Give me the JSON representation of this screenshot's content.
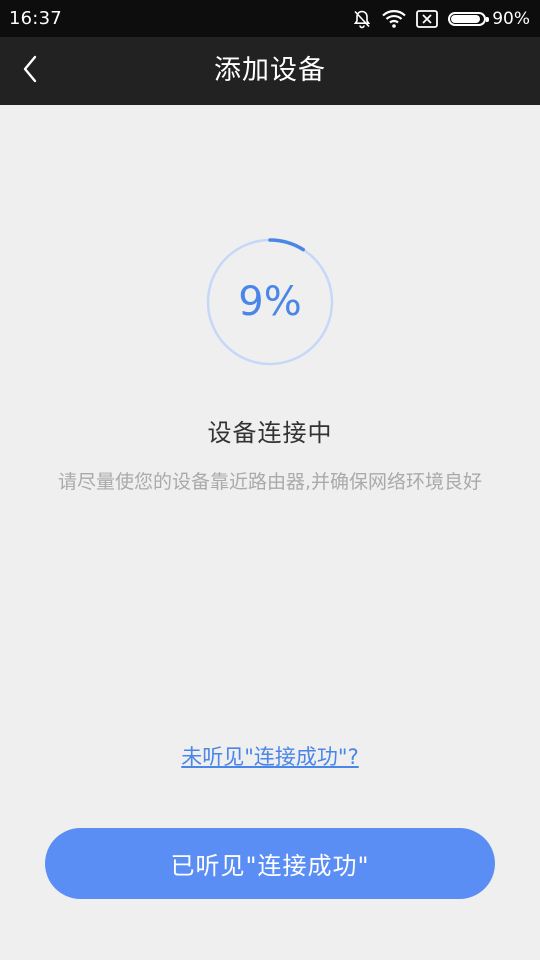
{
  "status_bar": {
    "time": "16:37",
    "battery_percent": "90%",
    "battery_level": 0.9,
    "icons": [
      "bell-off-icon",
      "wifi-icon",
      "sim-off-icon",
      "battery-icon"
    ]
  },
  "nav": {
    "title": "添加设备",
    "back_icon": "chevron-left-icon"
  },
  "progress": {
    "value": 9,
    "label": "9%",
    "ring_color": "#4a86e8",
    "track_color": "#c5d8f7"
  },
  "status": {
    "title": "设备连接中",
    "hint": "请尽量使您的设备靠近路由器,并确保网络环境良好"
  },
  "help_link": "未听见\"连接成功\"?",
  "confirm_button": "已听见\"连接成功\"",
  "colors": {
    "accent": "#4a86e8",
    "button": "#5b8ef4",
    "background": "#efefef",
    "navbar": "#222222"
  }
}
